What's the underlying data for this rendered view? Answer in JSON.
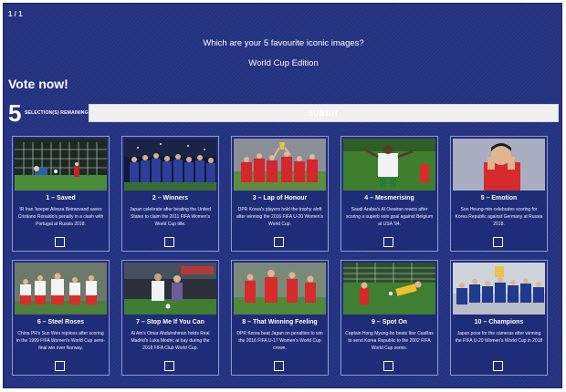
{
  "page_counter": "1 / 1",
  "question": "Which are your 5 favourite iconic images?",
  "subtitle": "World Cup Edition",
  "vote_heading": "Vote now!",
  "selections": {
    "count": "5",
    "label": "SELECTION(S) REMAINING"
  },
  "submit_label": "SUBMIT",
  "cards": [
    {
      "title": "1 – Saved",
      "caption": "IR Iran 'keeper Alireza Beiranvand saves Cristiano Ronaldo's penalty in a clash with Portugal at Russia 2018."
    },
    {
      "title": "2 – Winners",
      "caption": "Japan celebrate after beating the United States to claim the 2011 FIFA Women's World Cup title."
    },
    {
      "title": "3 – Lap of Honour",
      "caption": "DPR Korea's players hold the trophy aloft after winning the 2016 FIFA U-20 Women's World Cup."
    },
    {
      "title": "4 – Mesmerising",
      "caption": "Saudi Arabia's Al Owairan reacts after scoring a superb solo goal against Belgium at USA '94."
    },
    {
      "title": "5 – Emotion",
      "caption": "Son Heung-min celebrates scoring for Korea Republic against Germany at Russia 2018."
    },
    {
      "title": "6 – Steel Roses",
      "caption": "China PR's Sun Wen rejoices after scoring in the 1999 FIFA Women's World Cup semi-final win over Norway."
    },
    {
      "title": "7 – Stop Me If You Can",
      "caption": "Al Ain's Omar Abdulrahman holds Real Madrid's Luka Modric at bay during the 2018 FIFA Club World Cup."
    },
    {
      "title": "8 – That Winning Feeling",
      "caption": "DPR Korea beat Japan on penalties to win the 2016 FIFA U-17 Women's World Cup crown."
    },
    {
      "title": "9 – Spot On",
      "caption": "Captain Hong Myung-bo beats Iker Casillas to send Korea Republic to the 2002 FIFA World Cup semis."
    },
    {
      "title": "10 – Champions",
      "caption": "Japan pose for the cameras after winning the FIFA U-20 Women's World Cup in 2018"
    }
  ],
  "colors": {
    "panel_background": "#233280",
    "card_border": "#8f9bd0",
    "submit_background": "#f0f0f0"
  }
}
